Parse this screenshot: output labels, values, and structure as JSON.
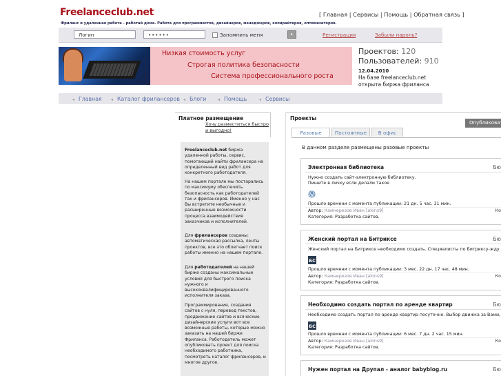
{
  "header": {
    "logo": "Freelanceclub.net",
    "tagline": "Фриланс и удаленная работа - работай дома. Работа для программистов, дизайнеров, менеджеров, копирайтеров, оптимизаторов.",
    "topnav": {
      "open": "[",
      "items": [
        "Главная",
        "Сервисы",
        "Помощь",
        "Обратная связь"
      ],
      "sep": "|",
      "close": "]"
    }
  },
  "login": {
    "login_value": "Логин",
    "password_value": "••••••",
    "remember_label": "Запомнить меня",
    "go_label": "▸",
    "register_link": "Регистрация",
    "forgot_link": "Забыли пароль?"
  },
  "banner": {
    "line1": "Низкая стоимость услуг",
    "line2": "Строгая политика безопасности",
    "line3": "Система профессионального роста"
  },
  "stats": {
    "projects_label": "Проектов:",
    "projects_value": "120",
    "users_label": "Пользователей:",
    "users_value": "910"
  },
  "news": {
    "date": "12.04.2010",
    "text": "На базе freelanceclub.net открыта биржа фриланса"
  },
  "mainnav": {
    "chevron": "◂",
    "items": [
      "Главная",
      "Каталог фрилансеров",
      "Блоги",
      "Помощь",
      "Сервисы"
    ]
  },
  "left": {
    "heading": "Платное размещение",
    "link": "Хочу разместиться быстро и выгодно!",
    "p1_brand": "Freelanceclub.net",
    "p1_rest": " биржа удаленной работы, сервис, помогающий найти фрилансера на определенный вид работ для конкретного работодателя.",
    "p2": "На нашем портале мы постарались по максимуму обеспечить безопасность как работодателей так и фрилансеров. Именно у нас Вы встретите необычные и расширенные возможности процесса взаимодействия заказчиков и исполнителей.",
    "p3_pre": "Для ",
    "p3_bold": "фрилансеров",
    "p3_rest": " созданы: автоматическая рассылка, ленты проектов, все это облегчает поиск работы именно на нашем портале.",
    "p4_pre": "Для ",
    "p4_bold": "работодателей",
    "p4_rest": " на нашей бирже созданы максимальные условия для быстрого поиска нужного и высококвалифицированного исполнителя заказа.",
    "p5": "Программирование, создания сайтов с нуля, перевод текстов, продвижение сайтов и всяческие дизайнерские услуги  вот все возможные работы, которые можно заказать на нашей бирже Фриланса. Работодатель может опубликовать проект для поиска необходимого работника, посмотреть каталог фрилансеров, и многое другое."
  },
  "projects": {
    "heading": "Проекты",
    "publish_button": "Опубликоват",
    "tabs": [
      "Разовые",
      "Постоянные",
      "В офис"
    ],
    "intro": "В данном разделе размещены разовые проекты",
    "time_label": "Прошло времени с момента публикации:",
    "author_label": "Автор:",
    "category_label": "Категория:",
    "items": [
      {
        "title": "Электронная библиотека",
        "budget": "Бю",
        "desc1": "Нужно создать сайт-электронную библиотеку.",
        "desc2": "Пишите в личку если делали такое",
        "icon": "wordpress-icon",
        "time": "21 дн. 5 час. 31 мин.",
        "author": "Камнерезов Иван [alons9]",
        "ko": "Ко",
        "category": "Разработка сайтов."
      },
      {
        "title": "Женский портал на Битриксе",
        "budget": "Бю",
        "desc1": "Женский портал на Битриксе необходимо создать. Специалисты по Битриксу-жду пре",
        "desc2": "",
        "icon": "bitrix-icon",
        "time": "3 мес. 22 дн. 17 час. 48 мин.",
        "author": "Камнерезов Иван [alons9]",
        "ko": "Ко",
        "category": "Разработка сайтов."
      },
      {
        "title": "Необходимо создать портал по аренде квартир",
        "budget": "Бю",
        "desc1": "Необходимо создать портал по аренде квартир посуточно. Выбор движка за Вами, за",
        "desc2": "",
        "icon": "bitrix-icon",
        "time": "6 мес. 7 дн. 2 час. 15 мин.",
        "author": "Камнерезов Иван [alons9]",
        "ko": "Ко",
        "category": "Разработка сайтов."
      },
      {
        "title": "Нужен портал на Друпал - аналог babyblog.ru",
        "budget": "Бю"
      }
    ]
  },
  "colors": {
    "logo_red": "#a8111a",
    "link_blue": "#5a6fa8",
    "banner_pink": "#f5c4c8"
  }
}
